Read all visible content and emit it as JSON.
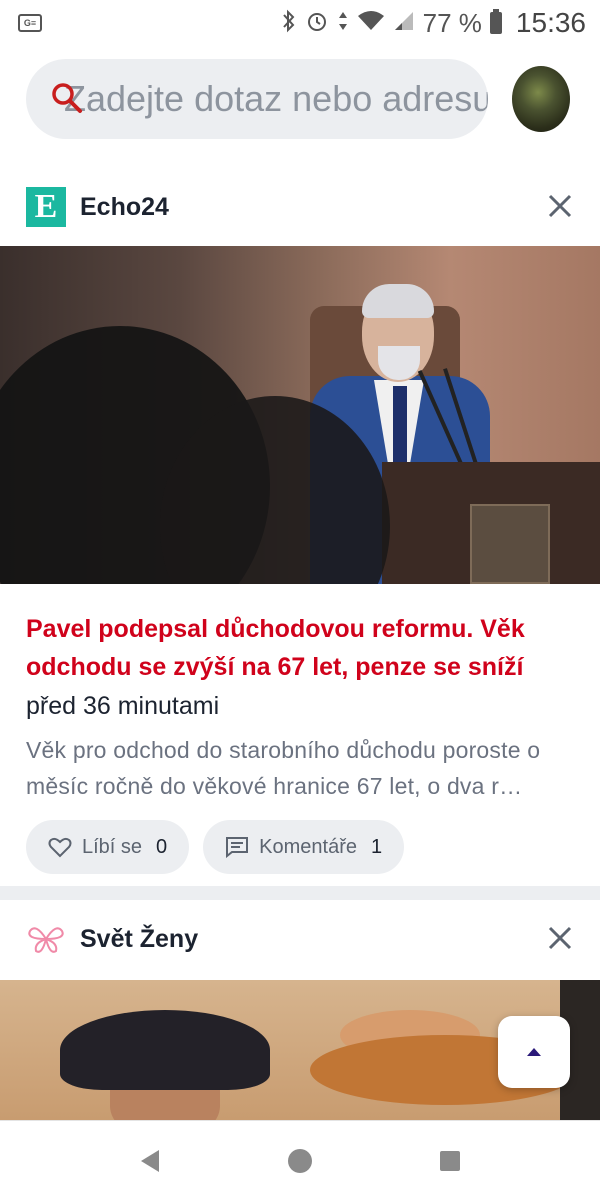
{
  "status_bar": {
    "app_icon": "G≡",
    "battery": "77 %",
    "time": "15:36"
  },
  "search": {
    "placeholder": "Zadejte dotaz nebo adresu"
  },
  "cards": [
    {
      "source": "Echo24",
      "logo_letter": "E",
      "headline": "Pavel podepsal důchodovou reformu. Věk odchodu se zvýší na 67 let, penze se sníží",
      "time": "před 36 minutami",
      "snippet": "Věk pro odchod do starobního důchodu poroste o měsíc ročně do věkové hranice 67 let, o dva r…",
      "like_label": "Líbí se",
      "like_count": "0",
      "comment_label": "Komentáře",
      "comment_count": "1"
    },
    {
      "source": "Svět Ženy"
    }
  ],
  "colors": {
    "headline_red": "#d0021b",
    "echo_logo": "#1bb8a0",
    "pill_bg": "#eceef1",
    "fab_arrow": "#2b1a7a"
  }
}
